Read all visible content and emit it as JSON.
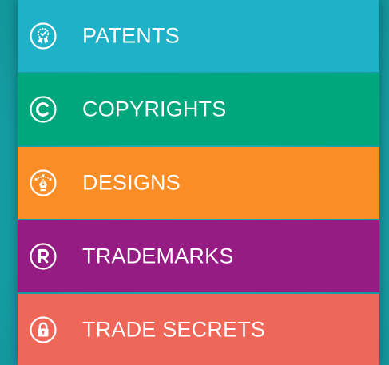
{
  "menu": {
    "items": [
      {
        "label": "PATENTS",
        "icon": "ribbon-award-icon",
        "color": "#1fb1c8"
      },
      {
        "label": "COPYRIGHTS",
        "icon": "copyright-icon",
        "color": "#00a77c"
      },
      {
        "label": "DESIGNS",
        "icon": "pen-tool-icon",
        "color": "#fb8d27"
      },
      {
        "label": "TRADEMARKS",
        "icon": "registered-icon",
        "color": "#951c83"
      },
      {
        "label": "TRADE SECRETS",
        "icon": "lock-icon",
        "color": "#ef6758"
      }
    ]
  },
  "background_color": "#1aa6ad"
}
